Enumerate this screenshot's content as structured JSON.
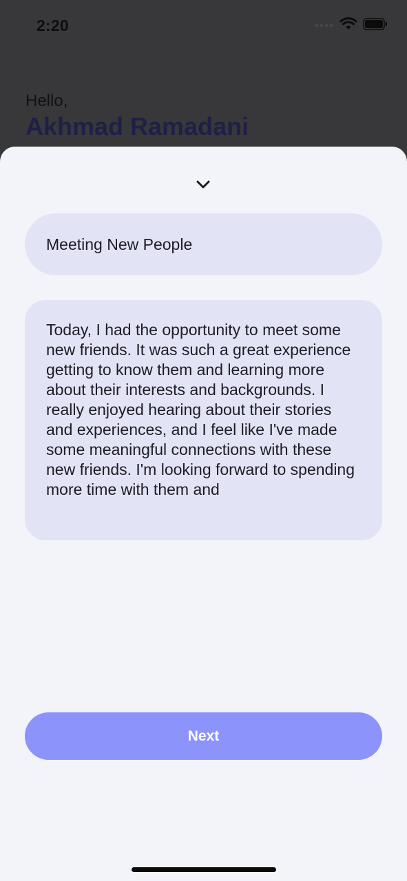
{
  "status_bar": {
    "time": "2:20",
    "icons": [
      "cellular-signal-icon",
      "wifi-icon",
      "battery-icon"
    ]
  },
  "header": {
    "greeting": "Hello,",
    "user_name": "Akhmad Ramadani"
  },
  "sheet": {
    "collapse_icon": "chevron-down-icon",
    "title_value": "Meeting New People",
    "body_value": "Today, I had the opportunity to meet some new friends. It was such a great experience getting to know them and learning more about their interests and backgrounds. I really enjoyed hearing about their stories and experiences, and I feel like I've made some meaningful connections with these new friends. I'm looking forward to spending more time with them and",
    "next_label": "Next"
  },
  "colors": {
    "backdrop": "#38383a",
    "sheet_bg": "#f3f4fa",
    "field_bg": "#e3e3f6",
    "accent": "#8c94fb",
    "name_color": "#1f2047"
  }
}
